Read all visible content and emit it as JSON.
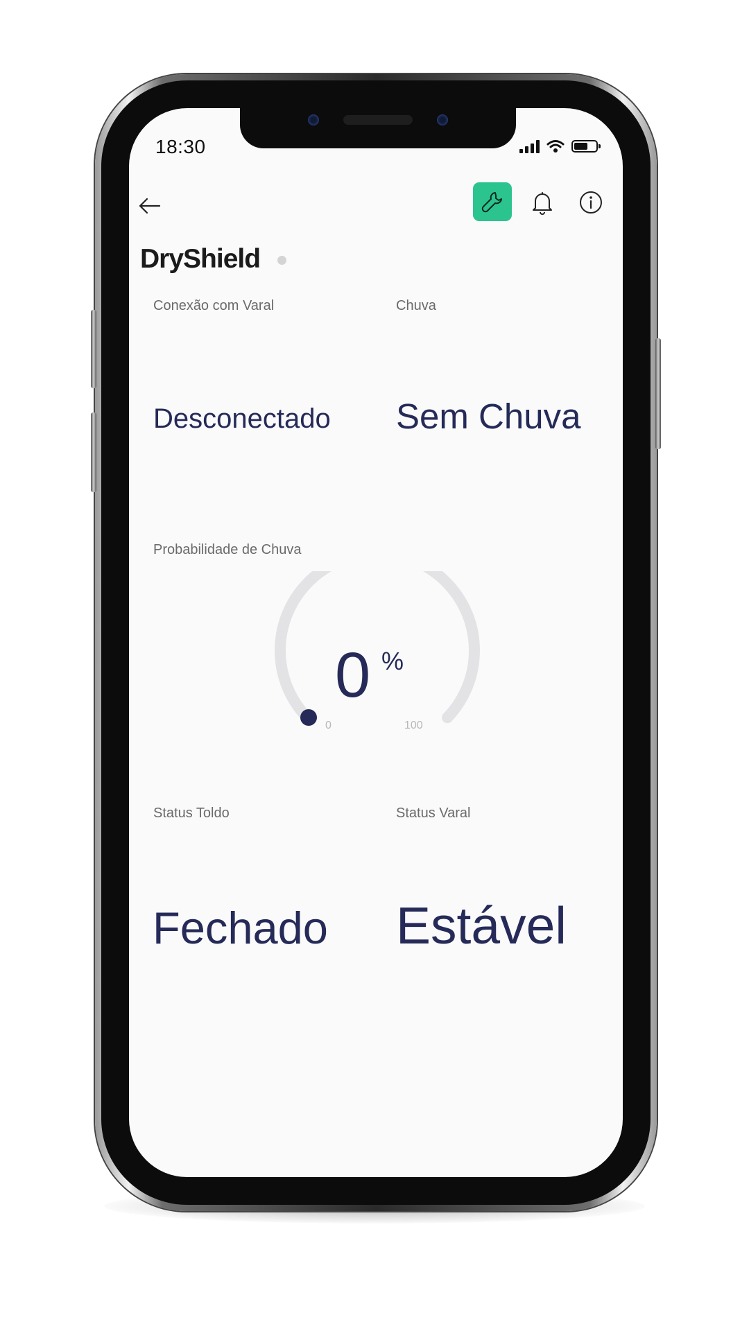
{
  "status_bar": {
    "time": "18:30"
  },
  "header": {
    "title": "DryShield",
    "colors": {
      "tool_button": "#2bc48f",
      "status_dot": "#d4d4d4"
    },
    "icons": [
      "back-arrow-icon",
      "wrench-icon",
      "bell-icon",
      "info-icon"
    ]
  },
  "cards": {
    "connection": {
      "label": "Conexão com Varal",
      "value": "Desconectado"
    },
    "rain": {
      "label": "Chuva",
      "value": "Sem Chuva"
    },
    "probability": {
      "label": "Probabilidade de Chuva",
      "value": "0",
      "unit": "%",
      "min": "0",
      "max": "100",
      "level": 0
    },
    "awning": {
      "label": "Status Toldo",
      "value": "Fechado"
    },
    "clothesline": {
      "label": "Status Varal",
      "value": "Estável"
    }
  },
  "colors": {
    "value_text": "#252a58",
    "gauge_track": "#e3e3e5",
    "gauge_indicator": "#252a58"
  }
}
